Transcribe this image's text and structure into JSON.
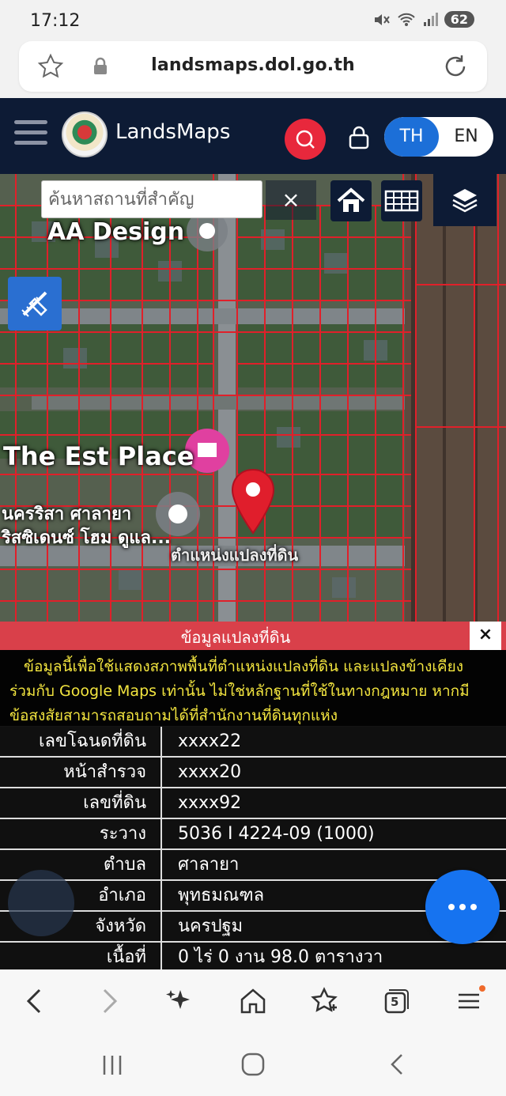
{
  "status_bar": {
    "time": "17:12",
    "battery": "62"
  },
  "browser": {
    "url": "landsmaps.dol.go.th"
  },
  "header": {
    "app_title": "LandsMaps",
    "lang_th": "TH",
    "lang_en": "EN",
    "brand_color": "#0d1b35",
    "accent_color": "#e8283c"
  },
  "map": {
    "search_placeholder": "ค้นหาสถานที่สำคัญ",
    "clear_label": "×",
    "labels": {
      "aa_design": "AA Design",
      "est_place": "The Est Place",
      "poi_line1": "นครริสา ศาลายา",
      "poi_line2": "ริสซิเดนซ์ โฮม ดูแล...",
      "parcel_location": "ตำแหน่งแปลงที่ดิน"
    }
  },
  "panel": {
    "title": "ข้อมูลแปลงที่ดิน",
    "close_label": "×",
    "disclaimer": [
      "ข้อมูลนี้เพื่อใช้แสดงสภาพพื้นที่ตำแหน่งแปลงที่ดิน และแปลงข้างเคียง",
      "ร่วมกับ Google Maps เท่านั้น ไม่ใช่หลักฐานที่ใช้ในทางกฎหมาย หากมี",
      "ข้อสงสัยสามารถสอบถามได้ที่สำนักงานที่ดินทุกแห่ง"
    ],
    "rows": [
      {
        "label": "เลขโฉนดที่ดิน",
        "value": "xxxx22"
      },
      {
        "label": "หน้าสำรวจ",
        "value": "xxxx20"
      },
      {
        "label": "เลขที่ดิน",
        "value": "xxxx92"
      },
      {
        "label": "ระวาง",
        "value": "5036 I 4224-09 (1000)"
      },
      {
        "label": "ตำบล",
        "value": "ศาลายา"
      },
      {
        "label": "อำเภอ",
        "value": "พุทธมณฑล"
      },
      {
        "label": "จังหวัด",
        "value": "นครปฐม"
      },
      {
        "label": "เนื้อที่",
        "value": "0 ไร่ 0 งาน 98.0 ตารางวา"
      }
    ]
  },
  "toolbar": {
    "tabs_count": "5"
  }
}
